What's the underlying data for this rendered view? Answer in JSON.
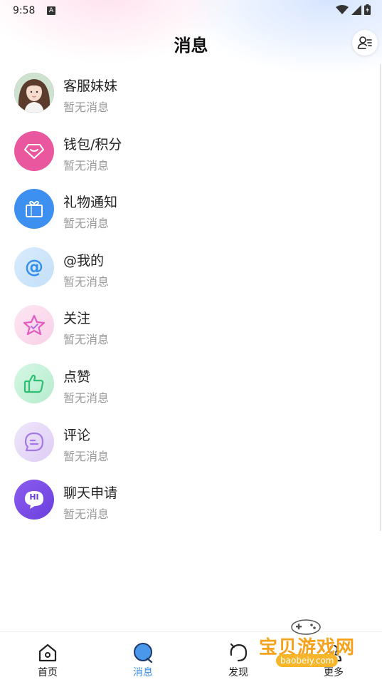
{
  "status_bar": {
    "time": "9:58",
    "notif_letter": "A"
  },
  "header": {
    "title": "消息"
  },
  "messages": [
    {
      "title": "客服妹妹",
      "subtitle": "暂无消息",
      "icon": "customer-service-avatar"
    },
    {
      "title": "钱包/积分",
      "subtitle": "暂无消息",
      "icon": "diamond-icon",
      "color": "#e9579f"
    },
    {
      "title": "礼物通知",
      "subtitle": "暂无消息",
      "icon": "gift-icon",
      "color": "#3d8ff0"
    },
    {
      "title": "@我的",
      "subtitle": "暂无消息",
      "icon": "at-icon",
      "color": "#cfe6fb"
    },
    {
      "title": "关注",
      "subtitle": "暂无消息",
      "icon": "star-icon",
      "color": "#fbdcef"
    },
    {
      "title": "点赞",
      "subtitle": "暂无消息",
      "icon": "thumbs-up-icon",
      "color": "#c9f2dc"
    },
    {
      "title": "评论",
      "subtitle": "暂无消息",
      "icon": "comment-icon",
      "color": "#e8dcf8"
    },
    {
      "title": "聊天申请",
      "subtitle": "暂无消息",
      "icon": "hi-chat-icon",
      "color": "#7b4ce8",
      "badge_text": "HI"
    }
  ],
  "bottom_nav": {
    "items": [
      {
        "label": "首页",
        "icon": "home-icon",
        "active": false
      },
      {
        "label": "消息",
        "icon": "message-icon",
        "active": true
      },
      {
        "label": "发现",
        "icon": "discover-icon",
        "active": false
      },
      {
        "label": "更多",
        "icon": "more-icon",
        "active": false
      }
    ],
    "active_color": "#3a8ee6"
  },
  "watermark": {
    "text": "宝贝游戏网",
    "url": "baobeiy.com"
  }
}
